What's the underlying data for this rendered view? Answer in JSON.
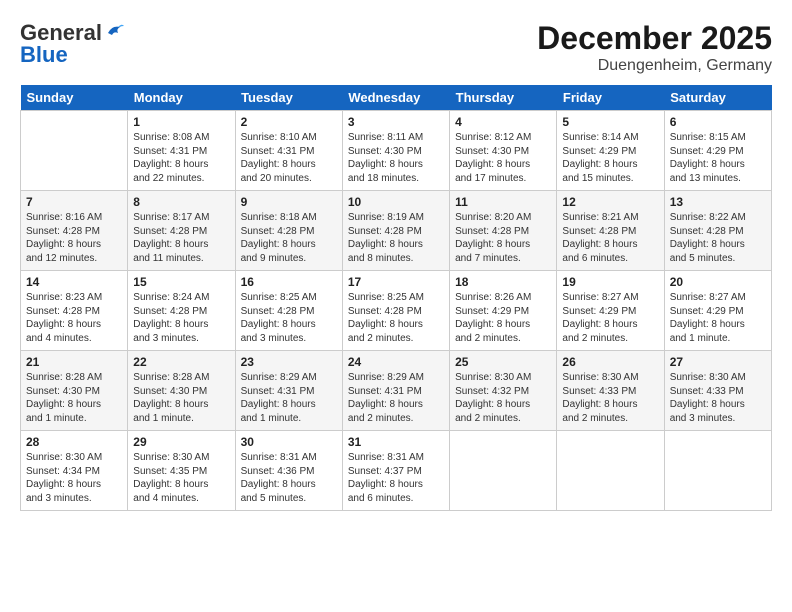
{
  "header": {
    "logo_general": "General",
    "logo_blue": "Blue",
    "month": "December 2025",
    "location": "Duengenheim, Germany"
  },
  "weekdays": [
    "Sunday",
    "Monday",
    "Tuesday",
    "Wednesday",
    "Thursday",
    "Friday",
    "Saturday"
  ],
  "weeks": [
    [
      {
        "day": "",
        "info": ""
      },
      {
        "day": "1",
        "info": "Sunrise: 8:08 AM\nSunset: 4:31 PM\nDaylight: 8 hours\nand 22 minutes."
      },
      {
        "day": "2",
        "info": "Sunrise: 8:10 AM\nSunset: 4:31 PM\nDaylight: 8 hours\nand 20 minutes."
      },
      {
        "day": "3",
        "info": "Sunrise: 8:11 AM\nSunset: 4:30 PM\nDaylight: 8 hours\nand 18 minutes."
      },
      {
        "day": "4",
        "info": "Sunrise: 8:12 AM\nSunset: 4:30 PM\nDaylight: 8 hours\nand 17 minutes."
      },
      {
        "day": "5",
        "info": "Sunrise: 8:14 AM\nSunset: 4:29 PM\nDaylight: 8 hours\nand 15 minutes."
      },
      {
        "day": "6",
        "info": "Sunrise: 8:15 AM\nSunset: 4:29 PM\nDaylight: 8 hours\nand 13 minutes."
      }
    ],
    [
      {
        "day": "7",
        "info": "Sunrise: 8:16 AM\nSunset: 4:28 PM\nDaylight: 8 hours\nand 12 minutes."
      },
      {
        "day": "8",
        "info": "Sunrise: 8:17 AM\nSunset: 4:28 PM\nDaylight: 8 hours\nand 11 minutes."
      },
      {
        "day": "9",
        "info": "Sunrise: 8:18 AM\nSunset: 4:28 PM\nDaylight: 8 hours\nand 9 minutes."
      },
      {
        "day": "10",
        "info": "Sunrise: 8:19 AM\nSunset: 4:28 PM\nDaylight: 8 hours\nand 8 minutes."
      },
      {
        "day": "11",
        "info": "Sunrise: 8:20 AM\nSunset: 4:28 PM\nDaylight: 8 hours\nand 7 minutes."
      },
      {
        "day": "12",
        "info": "Sunrise: 8:21 AM\nSunset: 4:28 PM\nDaylight: 8 hours\nand 6 minutes."
      },
      {
        "day": "13",
        "info": "Sunrise: 8:22 AM\nSunset: 4:28 PM\nDaylight: 8 hours\nand 5 minutes."
      }
    ],
    [
      {
        "day": "14",
        "info": "Sunrise: 8:23 AM\nSunset: 4:28 PM\nDaylight: 8 hours\nand 4 minutes."
      },
      {
        "day": "15",
        "info": "Sunrise: 8:24 AM\nSunset: 4:28 PM\nDaylight: 8 hours\nand 3 minutes."
      },
      {
        "day": "16",
        "info": "Sunrise: 8:25 AM\nSunset: 4:28 PM\nDaylight: 8 hours\nand 3 minutes."
      },
      {
        "day": "17",
        "info": "Sunrise: 8:25 AM\nSunset: 4:28 PM\nDaylight: 8 hours\nand 2 minutes."
      },
      {
        "day": "18",
        "info": "Sunrise: 8:26 AM\nSunset: 4:29 PM\nDaylight: 8 hours\nand 2 minutes."
      },
      {
        "day": "19",
        "info": "Sunrise: 8:27 AM\nSunset: 4:29 PM\nDaylight: 8 hours\nand 2 minutes."
      },
      {
        "day": "20",
        "info": "Sunrise: 8:27 AM\nSunset: 4:29 PM\nDaylight: 8 hours\nand 1 minute."
      }
    ],
    [
      {
        "day": "21",
        "info": "Sunrise: 8:28 AM\nSunset: 4:30 PM\nDaylight: 8 hours\nand 1 minute."
      },
      {
        "day": "22",
        "info": "Sunrise: 8:28 AM\nSunset: 4:30 PM\nDaylight: 8 hours\nand 1 minute."
      },
      {
        "day": "23",
        "info": "Sunrise: 8:29 AM\nSunset: 4:31 PM\nDaylight: 8 hours\nand 1 minute."
      },
      {
        "day": "24",
        "info": "Sunrise: 8:29 AM\nSunset: 4:31 PM\nDaylight: 8 hours\nand 2 minutes."
      },
      {
        "day": "25",
        "info": "Sunrise: 8:30 AM\nSunset: 4:32 PM\nDaylight: 8 hours\nand 2 minutes."
      },
      {
        "day": "26",
        "info": "Sunrise: 8:30 AM\nSunset: 4:33 PM\nDaylight: 8 hours\nand 2 minutes."
      },
      {
        "day": "27",
        "info": "Sunrise: 8:30 AM\nSunset: 4:33 PM\nDaylight: 8 hours\nand 3 minutes."
      }
    ],
    [
      {
        "day": "28",
        "info": "Sunrise: 8:30 AM\nSunset: 4:34 PM\nDaylight: 8 hours\nand 3 minutes."
      },
      {
        "day": "29",
        "info": "Sunrise: 8:30 AM\nSunset: 4:35 PM\nDaylight: 8 hours\nand 4 minutes."
      },
      {
        "day": "30",
        "info": "Sunrise: 8:31 AM\nSunset: 4:36 PM\nDaylight: 8 hours\nand 5 minutes."
      },
      {
        "day": "31",
        "info": "Sunrise: 8:31 AM\nSunset: 4:37 PM\nDaylight: 8 hours\nand 6 minutes."
      },
      {
        "day": "",
        "info": ""
      },
      {
        "day": "",
        "info": ""
      },
      {
        "day": "",
        "info": ""
      }
    ]
  ]
}
